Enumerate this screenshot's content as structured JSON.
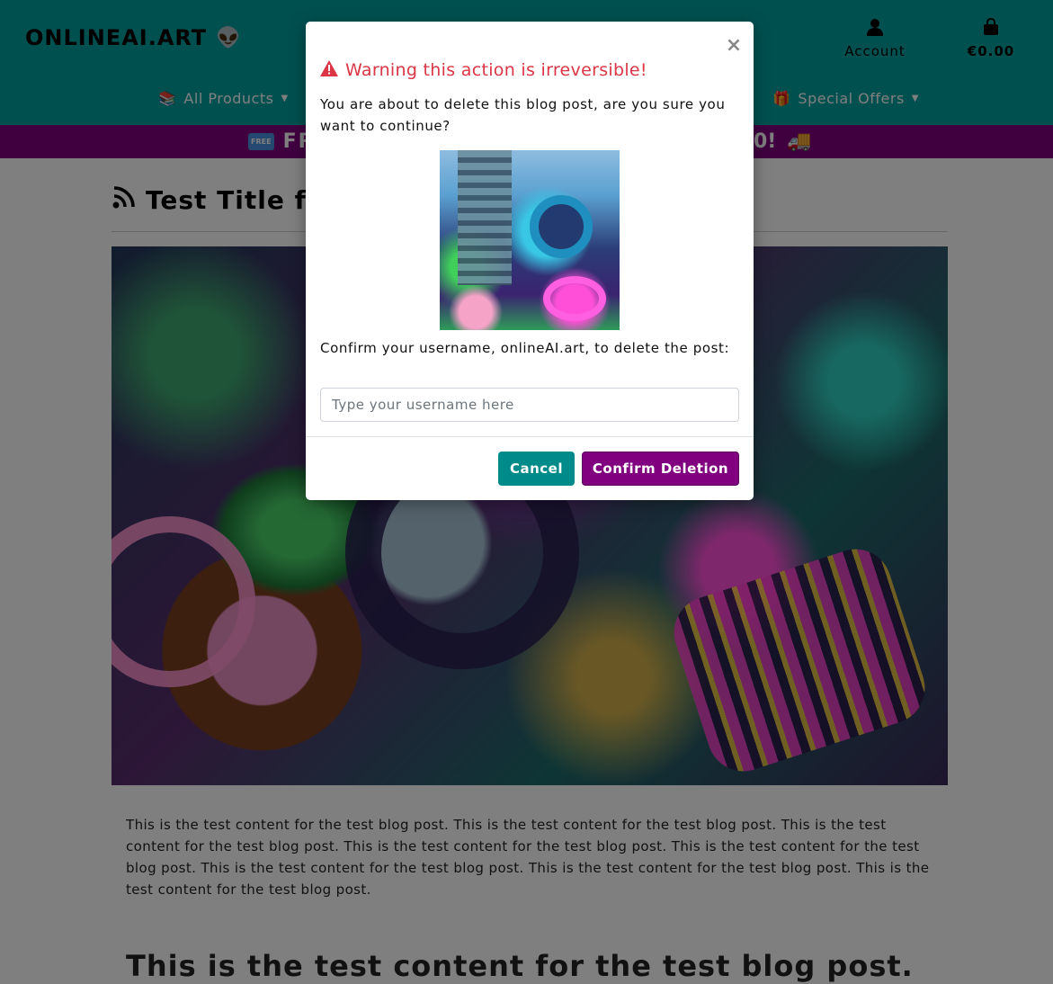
{
  "header": {
    "logo_text": "ONLINEAI.ART",
    "logo_icon": "alien-icon",
    "account_label": "Account",
    "account_icon": "user-icon",
    "bag_total": "€0.00",
    "bag_icon": "shopping-bag-icon"
  },
  "nav": {
    "all_products": "All Products",
    "special_offers": "Special Offers"
  },
  "promo": {
    "left_text": "FR",
    "free_badge": "FREE",
    "right_text": "0!",
    "truck_icon": "delivery-truck-icon"
  },
  "post": {
    "title": "Test Title fo",
    "title_icon": "rss-feed-icon",
    "body": "This is the test content for the test blog post. This is the test content for the test blog post. This is the test content for the test blog post. This is the test content for the test blog post. This is the test content for the test blog post.  This is the test content for the test blog post. This is the test content for the test blog post. This is the test content for the test blog post.",
    "heading": "This is the test content for the test blog post."
  },
  "modal": {
    "title": "Warning this action is irreversible!",
    "title_icon": "warning-triangle-icon",
    "close_label": "×",
    "message": "You are about to delete this blog post, are you sure you want to continue?",
    "confirm_prompt": "Confirm your username, onlineAI.art, to delete the post:",
    "input_placeholder": "Type your username here",
    "input_value": "",
    "cancel_label": "Cancel",
    "confirm_label": "Confirm Deletion"
  },
  "colors": {
    "header_bg": "#00a0a0",
    "promo_bg": "#800080",
    "warning_red": "#dc3545",
    "cancel_btn": "#008b8b",
    "confirm_btn": "#800080"
  }
}
